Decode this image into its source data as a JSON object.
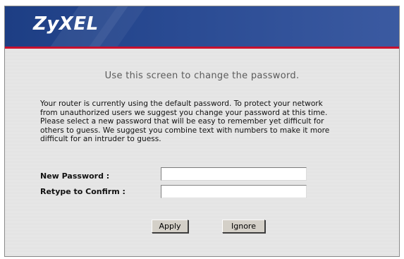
{
  "header": {
    "logo_text": "ZyXEL"
  },
  "main": {
    "title": "Use this screen to change the password.",
    "description": "Your router is currently using the default password. To protect your network\nfrom unauthorized users we suggest you change your password at this time.\nPlease select a new password that will be easy to remember yet difficult for\nothers to guess. We suggest you combine text with numbers to make it more\ndifficult for an intruder to guess."
  },
  "form": {
    "new_password_label": "New Password :",
    "new_password_value": "",
    "confirm_label": "Retype to Confirm :",
    "confirm_value": ""
  },
  "buttons": {
    "apply": "Apply",
    "ignore": "Ignore"
  },
  "colors": {
    "header_blue": "#1d3e84",
    "accent_red": "#c8102e"
  }
}
